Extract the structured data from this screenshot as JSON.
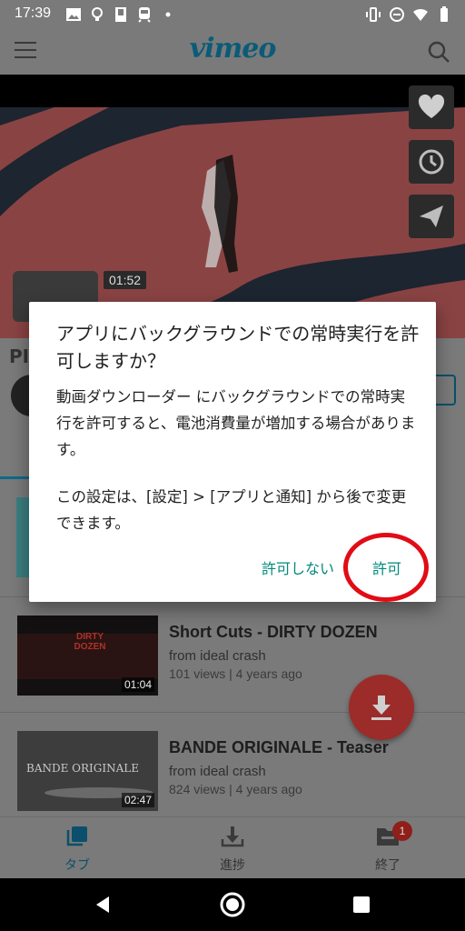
{
  "status_bar": {
    "time": "17:39"
  },
  "app_bar": {
    "logo": "vimeo"
  },
  "video": {
    "duration": "01:52"
  },
  "page": {
    "title_fragment": "PI"
  },
  "list": [
    {
      "title": "Short Cuts - DIRTY DOZEN",
      "from": "from ideal crash",
      "meta": "101 views | 4 years ago",
      "duration": "01:04",
      "thumb_text": "DIRTY DOZEN"
    },
    {
      "title": "BANDE ORIGINALE - Teaser",
      "from": "from ideal crash",
      "meta": "824 views | 4 years ago",
      "duration": "02:47",
      "thumb_text": "BANDE ORIGINALE"
    }
  ],
  "bottom_nav": {
    "tabs_label": "タブ",
    "progress_label": "進捗",
    "finished_label": "終了",
    "badge_count": "1"
  },
  "dialog": {
    "title": "アプリにバックグラウンドでの常時実行を許可しますか？",
    "body": "動画ダウンローダー にバックグラウンドでの常時実行を許可すると、電池消費量が増加する場合があります。",
    "body2": "この設定は、[設定] > [アプリと通知] から後で変更できます。",
    "deny_label": "許可しない",
    "allow_label": "許可"
  },
  "colors": {
    "accent": "#00897b",
    "highlight_ring": "#e10c15",
    "fab": "#9b2c29",
    "scrim": "#7a7a7a"
  },
  "icons": {
    "like": "heart-icon",
    "watch_later": "clock-icon",
    "share": "send-icon",
    "download": "download-icon"
  }
}
